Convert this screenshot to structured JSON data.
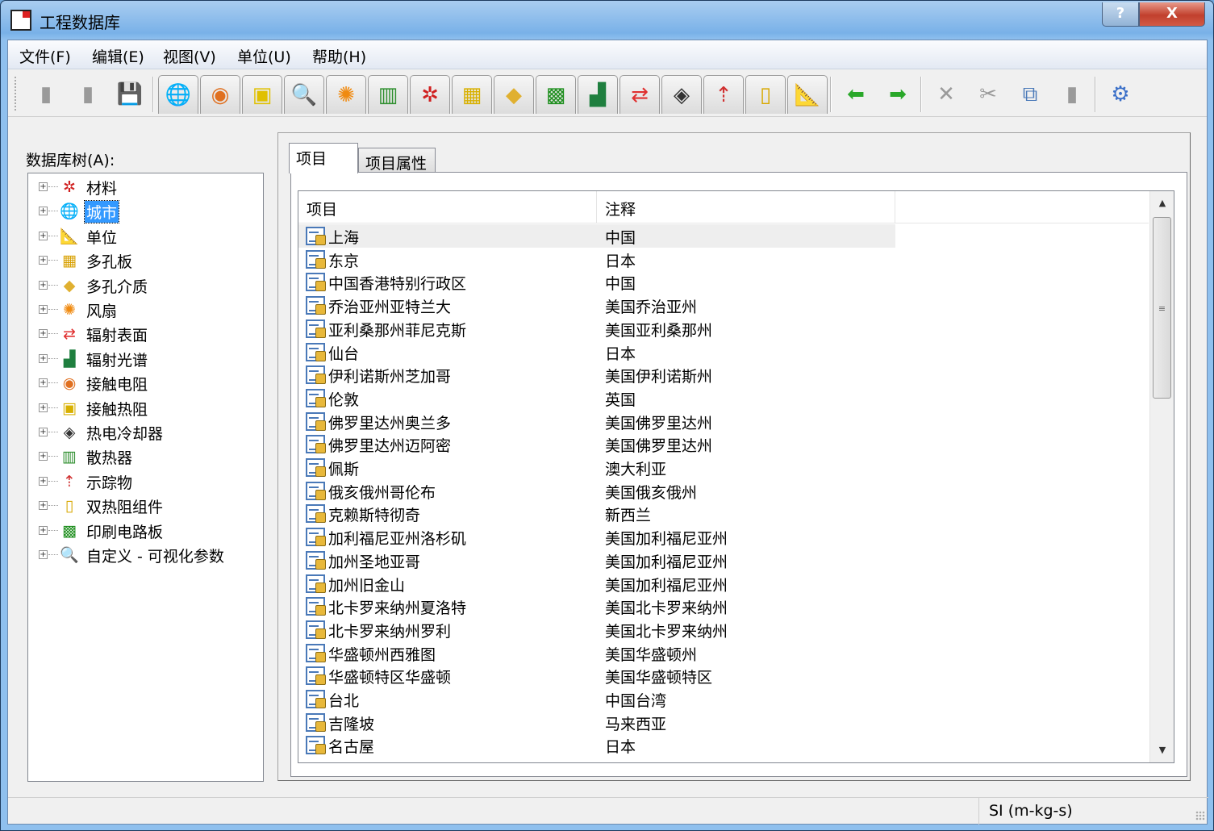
{
  "window": {
    "title": "工程数据库",
    "help_label": "?",
    "close_label": "X"
  },
  "menu": [
    "文件(F)",
    "编辑(E)",
    "视图(V)",
    "单位(U)",
    "帮助(H)"
  ],
  "toolbar": [
    {
      "name": "new-icon",
      "glyph": "▮",
      "color": "#9a9a9a",
      "tab": false
    },
    {
      "name": "open-icon",
      "glyph": "▮",
      "color": "#9a9a9a",
      "tab": false
    },
    {
      "name": "save-icon",
      "glyph": "💾",
      "color": "#2b5fb0",
      "tab": false
    },
    {
      "name": "city-globe-icon",
      "glyph": "🌐",
      "color": "#3a8f3a",
      "tab": true
    },
    {
      "name": "contact-resistance-icon",
      "glyph": "◉",
      "color": "#e07020",
      "tab": true
    },
    {
      "name": "contact-thermal-icon",
      "glyph": "▣",
      "color": "#e0c000",
      "tab": true
    },
    {
      "name": "custom-visualization-icon",
      "glyph": "🔍",
      "color": "#c03030",
      "tab": true
    },
    {
      "name": "fan-icon",
      "glyph": "✺",
      "color": "#f08a10",
      "tab": true
    },
    {
      "name": "heatsink-icon",
      "glyph": "▥",
      "color": "#2f8f2f",
      "tab": true
    },
    {
      "name": "material-icon",
      "glyph": "✲",
      "color": "#d02020",
      "tab": true
    },
    {
      "name": "perforated-plate-icon",
      "glyph": "▦",
      "color": "#d8b000",
      "tab": true
    },
    {
      "name": "porous-media-icon",
      "glyph": "◆",
      "color": "#e0b030",
      "tab": true
    },
    {
      "name": "pcb-icon",
      "glyph": "▩",
      "color": "#1f8f1f",
      "tab": true
    },
    {
      "name": "radiation-spectrum-icon",
      "glyph": "▟",
      "color": "#1f7f3f",
      "tab": true
    },
    {
      "name": "radiation-surface-icon",
      "glyph": "⇄",
      "color": "#e03030",
      "tab": true
    },
    {
      "name": "thermoelectric-cooler-icon",
      "glyph": "◈",
      "color": "#333333",
      "tab": true
    },
    {
      "name": "tracer-icon",
      "glyph": "⇡",
      "color": "#d03030",
      "tab": true
    },
    {
      "name": "two-resistor-icon",
      "glyph": "▯",
      "color": "#d8a800",
      "tab": true
    },
    {
      "name": "units-icon",
      "glyph": "📐",
      "color": "#4a6fc0",
      "tab": true
    },
    {
      "name": "back-arrow-icon",
      "glyph": "⬅",
      "color": "#2aa82a",
      "tab": false
    },
    {
      "name": "forward-arrow-icon",
      "glyph": "➡",
      "color": "#2aa82a",
      "tab": false
    },
    {
      "name": "delete-icon",
      "glyph": "✕",
      "color": "#9a9a9a",
      "tab": false
    },
    {
      "name": "cut-icon",
      "glyph": "✂",
      "color": "#9a9a9a",
      "tab": false
    },
    {
      "name": "copy-icon",
      "glyph": "⧉",
      "color": "#4a79b8",
      "tab": false
    },
    {
      "name": "paste-icon",
      "glyph": "▮",
      "color": "#9a9a9a",
      "tab": false
    },
    {
      "name": "settings-gear-icon",
      "glyph": "⚙",
      "color": "#3a6fc8",
      "tab": false
    }
  ],
  "tree": {
    "label": "数据库树(A):",
    "items": [
      {
        "label": "材料",
        "icon": "material-icon",
        "glyph": "✲",
        "color": "#d02020"
      },
      {
        "label": "城市",
        "icon": "globe-icon",
        "glyph": "🌐",
        "color": "#3a8f3a",
        "selected": true
      },
      {
        "label": "单位",
        "icon": "units-icon",
        "glyph": "📐",
        "color": "#4a6fc0"
      },
      {
        "label": "多孔板",
        "icon": "perforated-plate-icon",
        "glyph": "▦",
        "color": "#d8a000"
      },
      {
        "label": "多孔介质",
        "icon": "porous-media-icon",
        "glyph": "◆",
        "color": "#e0b030"
      },
      {
        "label": "风扇",
        "icon": "fan-icon",
        "glyph": "✺",
        "color": "#f08a10"
      },
      {
        "label": "辐射表面",
        "icon": "radiation-surface-icon",
        "glyph": "⇄",
        "color": "#e03030"
      },
      {
        "label": "辐射光谱",
        "icon": "radiation-spectrum-icon",
        "glyph": "▟",
        "color": "#1f7f3f"
      },
      {
        "label": "接触电阻",
        "icon": "contact-resistance-icon",
        "glyph": "◉",
        "color": "#e07020"
      },
      {
        "label": "接触热阻",
        "icon": "contact-thermal-icon",
        "glyph": "▣",
        "color": "#d8b000"
      },
      {
        "label": "热电冷却器",
        "icon": "thermoelectric-cooler-icon",
        "glyph": "◈",
        "color": "#333333"
      },
      {
        "label": "散热器",
        "icon": "heatsink-icon",
        "glyph": "▥",
        "color": "#2f8f2f"
      },
      {
        "label": "示踪物",
        "icon": "tracer-icon",
        "glyph": "⇡",
        "color": "#d03030"
      },
      {
        "label": "双热阻组件",
        "icon": "two-resistor-icon",
        "glyph": "▯",
        "color": "#d8a800"
      },
      {
        "label": "印刷电路板",
        "icon": "pcb-icon",
        "glyph": "▩",
        "color": "#1f8f1f"
      },
      {
        "label": "自定义 - 可视化参数",
        "icon": "visualization-icon",
        "glyph": "🔍",
        "color": "#2a6fc0"
      }
    ]
  },
  "tabs": [
    {
      "label": "项目",
      "active": true
    },
    {
      "label": "项目属性",
      "active": false
    }
  ],
  "list": {
    "columns": [
      "项目",
      "注释"
    ],
    "rows": [
      [
        "上海",
        "中国"
      ],
      [
        "东京",
        "日本"
      ],
      [
        "中国香港特别行政区",
        "中国"
      ],
      [
        "乔治亚州亚特兰大",
        "美国乔治亚州"
      ],
      [
        "亚利桑那州菲尼克斯",
        "美国亚利桑那州"
      ],
      [
        "仙台",
        "日本"
      ],
      [
        "伊利诺斯州芝加哥",
        "美国伊利诺斯州"
      ],
      [
        "伦敦",
        "英国"
      ],
      [
        "佛罗里达州奥兰多",
        "美国佛罗里达州"
      ],
      [
        "佛罗里达州迈阿密",
        "美国佛罗里达州"
      ],
      [
        "佩斯",
        "澳大利亚"
      ],
      [
        "俄亥俄州哥伦布",
        "美国俄亥俄州"
      ],
      [
        "克赖斯特彻奇",
        "新西兰"
      ],
      [
        "加利福尼亚州洛杉矶",
        "美国加利福尼亚州"
      ],
      [
        "加州圣地亚哥",
        "美国加利福尼亚州"
      ],
      [
        "加州旧金山",
        "美国加利福尼亚州"
      ],
      [
        "北卡罗来纳州夏洛特",
        "美国北卡罗来纳州"
      ],
      [
        "北卡罗来纳州罗利",
        "美国北卡罗来纳州"
      ],
      [
        "华盛顿州西雅图",
        "美国华盛顿州"
      ],
      [
        "华盛顿特区华盛顿",
        "美国华盛顿特区"
      ],
      [
        "台北",
        "中国台湾"
      ],
      [
        "吉隆坡",
        "马来西亚"
      ],
      [
        "名古屋",
        "日本"
      ]
    ]
  },
  "status": {
    "units": "SI (m-kg-s)"
  }
}
